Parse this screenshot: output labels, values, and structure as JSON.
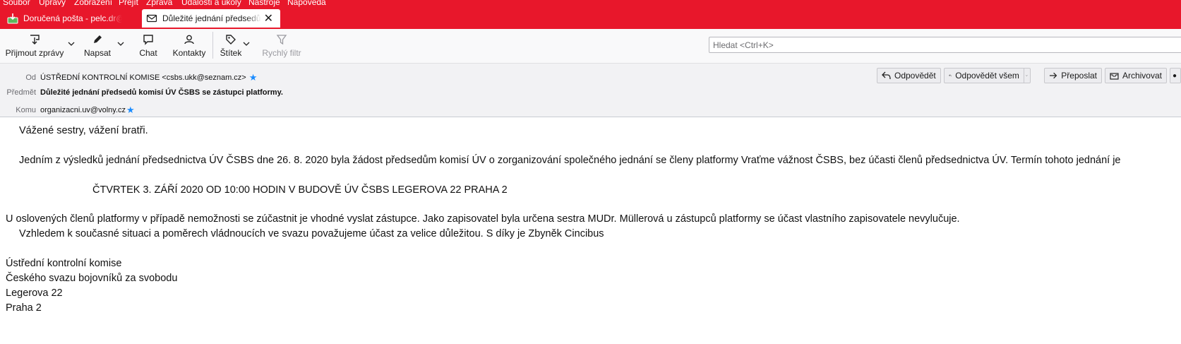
{
  "menu": [
    "Soubor",
    "Úpravy",
    "Zobrazení",
    "Přejít",
    "Zpráva",
    "Události a úkoly",
    "Nástroje",
    "Nápověda"
  ],
  "tabs": {
    "inbox_label": "Doručená pošta - pelc.dr@seznam.cz",
    "message_label": "Důležité jednání předsedů komisí ÚV ČSBS"
  },
  "toolbar": {
    "get_mail": "Přijmout zprávy",
    "write": "Napsat",
    "chat": "Chat",
    "contacts": "Kontakty",
    "tag": "Štítek",
    "quick_filter": "Rychlý filtr",
    "search_placeholder": "Hledat <Ctrl+K>"
  },
  "header": {
    "from_label": "Od",
    "from_value": "ÚSTŘEDNÍ KONTROLNÍ KOMISE <csbs.ukk@seznam.cz>",
    "subject_label": "Předmět",
    "subject_value": "Důležité jednání předsedů komisí ÚV ČSBS se zástupci platformy.",
    "to_label": "Komu",
    "to_value": "organizacni.uv@volny.cz",
    "actions": {
      "reply": "Odpovědět",
      "reply_all": "Odpovědět všem",
      "forward": "Přeposlat",
      "archive": "Archivovat"
    }
  },
  "body": {
    "greeting": "Vážené sestry, vážení bratři.",
    "para1": "Jedním z výsledků jednání předsednictva ÚV ČSBS dne 26. 8. 2020 byla žádost předsedům komisí ÚV o zorganizování společného jednání se členy platformy Vraťme vážnost ČSBS, bez účasti členů předsednictva ÚV. Termín tohoto jednání  je",
    "meeting": "ČTVRTEK 3. ZÁŘÍ 2020 OD 10:00 HODIN V BUDOVĚ ÚV ČSBS LEGEROVA 22  PRAHA 2",
    "para2": "U oslovených členů platformy v případě nemožnosti se zúčastnit je vhodné vyslat zástupce. Jako zapisovatel byla určena sestra MUDr. Müllerová u zástupců platformy se účast vlastního zapisovatele nevylučuje.",
    "para3": "Vzhledem k současné situaci a poměrech vládnoucích ve svazu považujeme účast za velice důležitou. S díky je Zbyněk Cincibus",
    "signature": [
      "Ústřední kontrolní komise",
      "Českého svazu bojovníků za svobodu",
      "Legerova 22",
      "Praha 2"
    ]
  }
}
